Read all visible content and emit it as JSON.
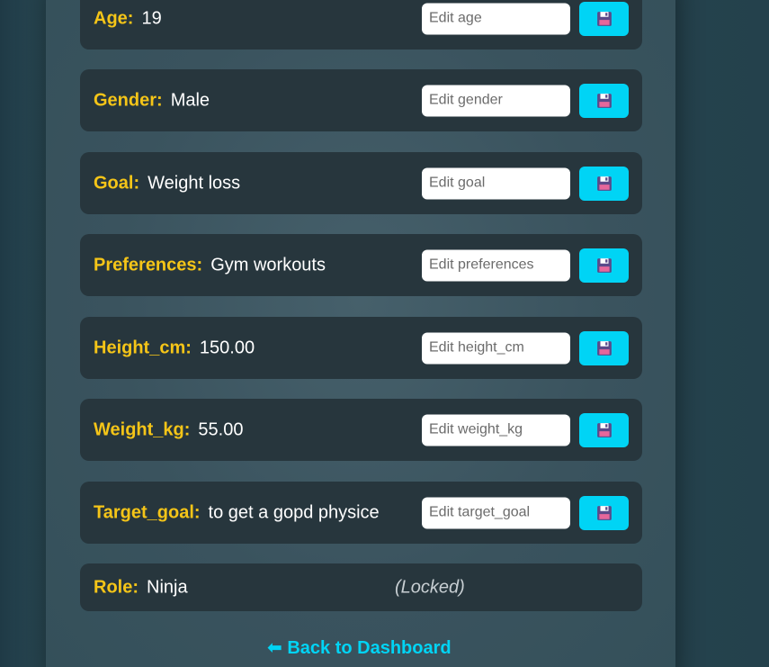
{
  "fields": [
    {
      "key": "age",
      "label": "Age:",
      "value": "19",
      "placeholder": "Edit age",
      "save_icon": "floppy-disk-icon"
    },
    {
      "key": "gender",
      "label": "Gender:",
      "value": "Male",
      "placeholder": "Edit gender",
      "save_icon": "floppy-disk-icon"
    },
    {
      "key": "goal",
      "label": "Goal:",
      "value": "Weight loss",
      "placeholder": "Edit goal",
      "save_icon": "floppy-disk-icon"
    },
    {
      "key": "preferences",
      "label": "Preferences:",
      "value": "Gym workouts",
      "placeholder": "Edit preferences",
      "save_icon": "floppy-disk-icon"
    },
    {
      "key": "height_cm",
      "label": "Height_cm:",
      "value": "150.00",
      "placeholder": "Edit height_cm",
      "save_icon": "floppy-disk-icon"
    },
    {
      "key": "weight_kg",
      "label": "Weight_kg:",
      "value": "55.00",
      "placeholder": "Edit weight_kg",
      "save_icon": "floppy-disk-icon"
    },
    {
      "key": "target_goal",
      "label": "Target_goal:",
      "value": "to get a gopd physice",
      "placeholder": "Edit target_goal",
      "save_icon": "floppy-disk-icon"
    }
  ],
  "role": {
    "label": "Role:",
    "value": "Ninja",
    "status": "(Locked)"
  },
  "back_link": {
    "arrow": "⬅",
    "label": "Back to Dashboard"
  },
  "colors": {
    "label": "#f5c518",
    "value": "#ffffff",
    "accent": "#00d4f5",
    "row_background": "#27363d",
    "panel_background": "#3f5862",
    "page_background": "#24414c"
  }
}
